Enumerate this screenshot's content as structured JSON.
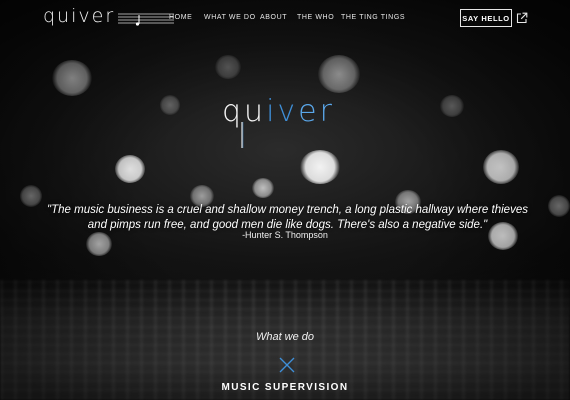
{
  "header": {
    "logo_text": "quiver",
    "nav": [
      "HOME",
      "WHAT WE DO",
      "ABOUT",
      "THE WHO",
      "THE TING TINGS"
    ],
    "say_hello": "SAY HELLO"
  },
  "hero": {
    "logo_parts": [
      "qu",
      "iv",
      "er"
    ],
    "quote": "\"The music business is a cruel and shallow money trench, a long plastic hallway where thieves and pimps run free, and good men die like dogs. There's also a negative side.\"",
    "author": "-Hunter S. Thompson"
  },
  "what_we_do": {
    "heading": "What we do",
    "first_item": "MUSIC SUPERVISION"
  },
  "colors": {
    "background": "#0a0a0a",
    "accent_blue": "#3f8fd8",
    "accent_light_blue": "#5aa7ea",
    "text": "#ffffff"
  },
  "icons": [
    "external-link-icon",
    "close-x-icon",
    "music-staff-icon"
  ]
}
